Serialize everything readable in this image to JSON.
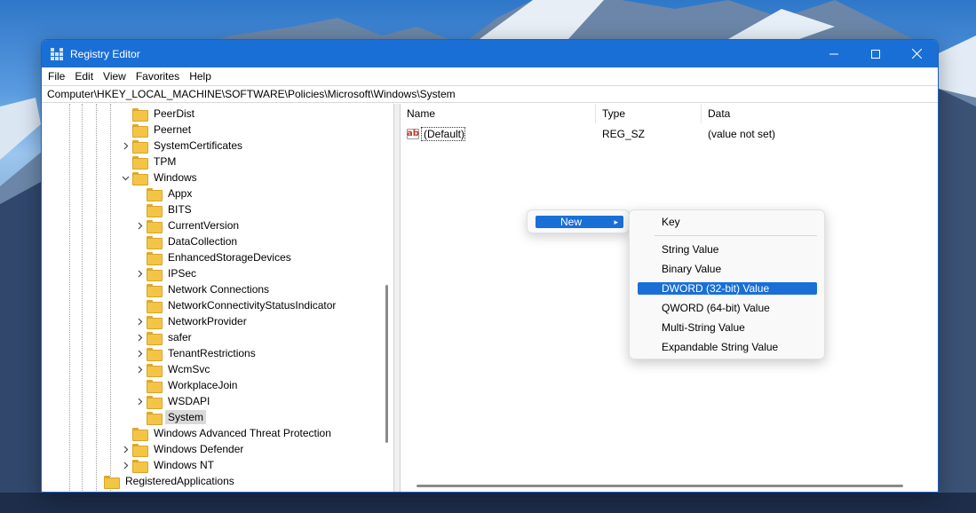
{
  "window": {
    "title": "Registry Editor"
  },
  "menubar": [
    "File",
    "Edit",
    "View",
    "Favorites",
    "Help"
  ],
  "address": "Computer\\HKEY_LOCAL_MACHINE\\SOFTWARE\\Policies\\Microsoft\\Windows\\System",
  "tree": [
    {
      "label": "PeerDist",
      "expandable": false
    },
    {
      "label": "Peernet",
      "expandable": false
    },
    {
      "label": "SystemCertificates",
      "expandable": true
    },
    {
      "label": "TPM",
      "expandable": false
    },
    {
      "label": "Windows",
      "expandable": true,
      "expanded": true
    },
    {
      "label": "Appx",
      "expandable": false
    },
    {
      "label": "BITS",
      "expandable": false
    },
    {
      "label": "CurrentVersion",
      "expandable": true
    },
    {
      "label": "DataCollection",
      "expandable": false
    },
    {
      "label": "EnhancedStorageDevices",
      "expandable": false
    },
    {
      "label": "IPSec",
      "expandable": true
    },
    {
      "label": "Network Connections",
      "expandable": false
    },
    {
      "label": "NetworkConnectivityStatusIndicator",
      "expandable": false
    },
    {
      "label": "NetworkProvider",
      "expandable": true
    },
    {
      "label": "safer",
      "expandable": true
    },
    {
      "label": "TenantRestrictions",
      "expandable": true
    },
    {
      "label": "WcmSvc",
      "expandable": true
    },
    {
      "label": "WorkplaceJoin",
      "expandable": false
    },
    {
      "label": "WSDAPI",
      "expandable": true
    },
    {
      "label": "System",
      "expandable": false,
      "selected": true
    },
    {
      "label": "Windows Advanced Threat Protection",
      "expandable": false
    },
    {
      "label": "Windows Defender",
      "expandable": true
    },
    {
      "label": "Windows NT",
      "expandable": true
    },
    {
      "label": "RegisteredApplications",
      "expandable": false
    }
  ],
  "list": {
    "columns": [
      "Name",
      "Type",
      "Data"
    ],
    "rows": [
      {
        "name": "(Default)",
        "type": "REG_SZ",
        "data": "(value not set)",
        "icon": "string-value-icon"
      }
    ]
  },
  "context_menu": {
    "new_label": "New",
    "submenu": [
      "Key",
      "String Value",
      "Binary Value",
      "DWORD (32-bit) Value",
      "QWORD (64-bit) Value",
      "Multi-String Value",
      "Expandable String Value"
    ],
    "highlighted": "DWORD (32-bit) Value"
  },
  "colors": {
    "accent": "#1a6fd6",
    "folder": "#f4c447"
  }
}
